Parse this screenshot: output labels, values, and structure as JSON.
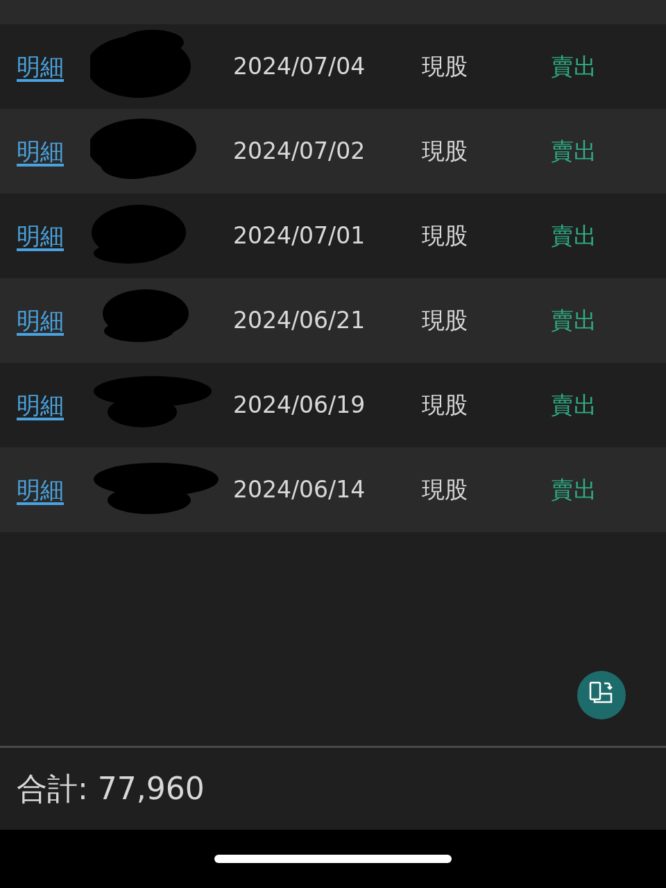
{
  "rows": [
    {
      "link": "明細",
      "date": "2024/07/04",
      "type": "現股",
      "action": "賣出"
    },
    {
      "link": "明細",
      "date": "2024/07/02",
      "type": "現股",
      "action": "賣出"
    },
    {
      "link": "明細",
      "date": "2024/07/01",
      "type": "現股",
      "action": "賣出"
    },
    {
      "link": "明細",
      "date": "2024/06/21",
      "type": "現股",
      "action": "賣出"
    },
    {
      "link": "明細",
      "date": "2024/06/19",
      "type": "現股",
      "action": "賣出"
    },
    {
      "link": "明細",
      "date": "2024/06/14",
      "type": "現股",
      "action": "賣出"
    }
  ],
  "footer": {
    "total": "合計: 77,960"
  }
}
